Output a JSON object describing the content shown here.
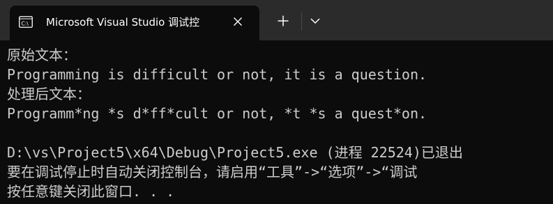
{
  "tab": {
    "title": "Microsoft Visual Studio 调试控",
    "icon": "console-app-icon",
    "close_icon": "close-icon"
  },
  "toolbar": {
    "new_tab_icon": "plus-icon",
    "dropdown_icon": "chevron-down-icon"
  },
  "console": {
    "lines": [
      "原始文本：",
      "Programming is difficult or not, it is a question.",
      "处理后文本：",
      "Programm*ng *s d*ff*cult or not, *t *s a quest*on.",
      "",
      "D:\\vs\\Project5\\x64\\Debug\\Project5.exe (进程 22524)已退出",
      "要在调试停止时自动关闭控制台，请启用“工具”->“选项”->“调试",
      "按任意键关闭此窗口. . ."
    ]
  },
  "colors": {
    "background": "#0c0c0c",
    "tabbar": "#2b2b2b",
    "text": "#cccccc",
    "title": "#ffffff"
  }
}
